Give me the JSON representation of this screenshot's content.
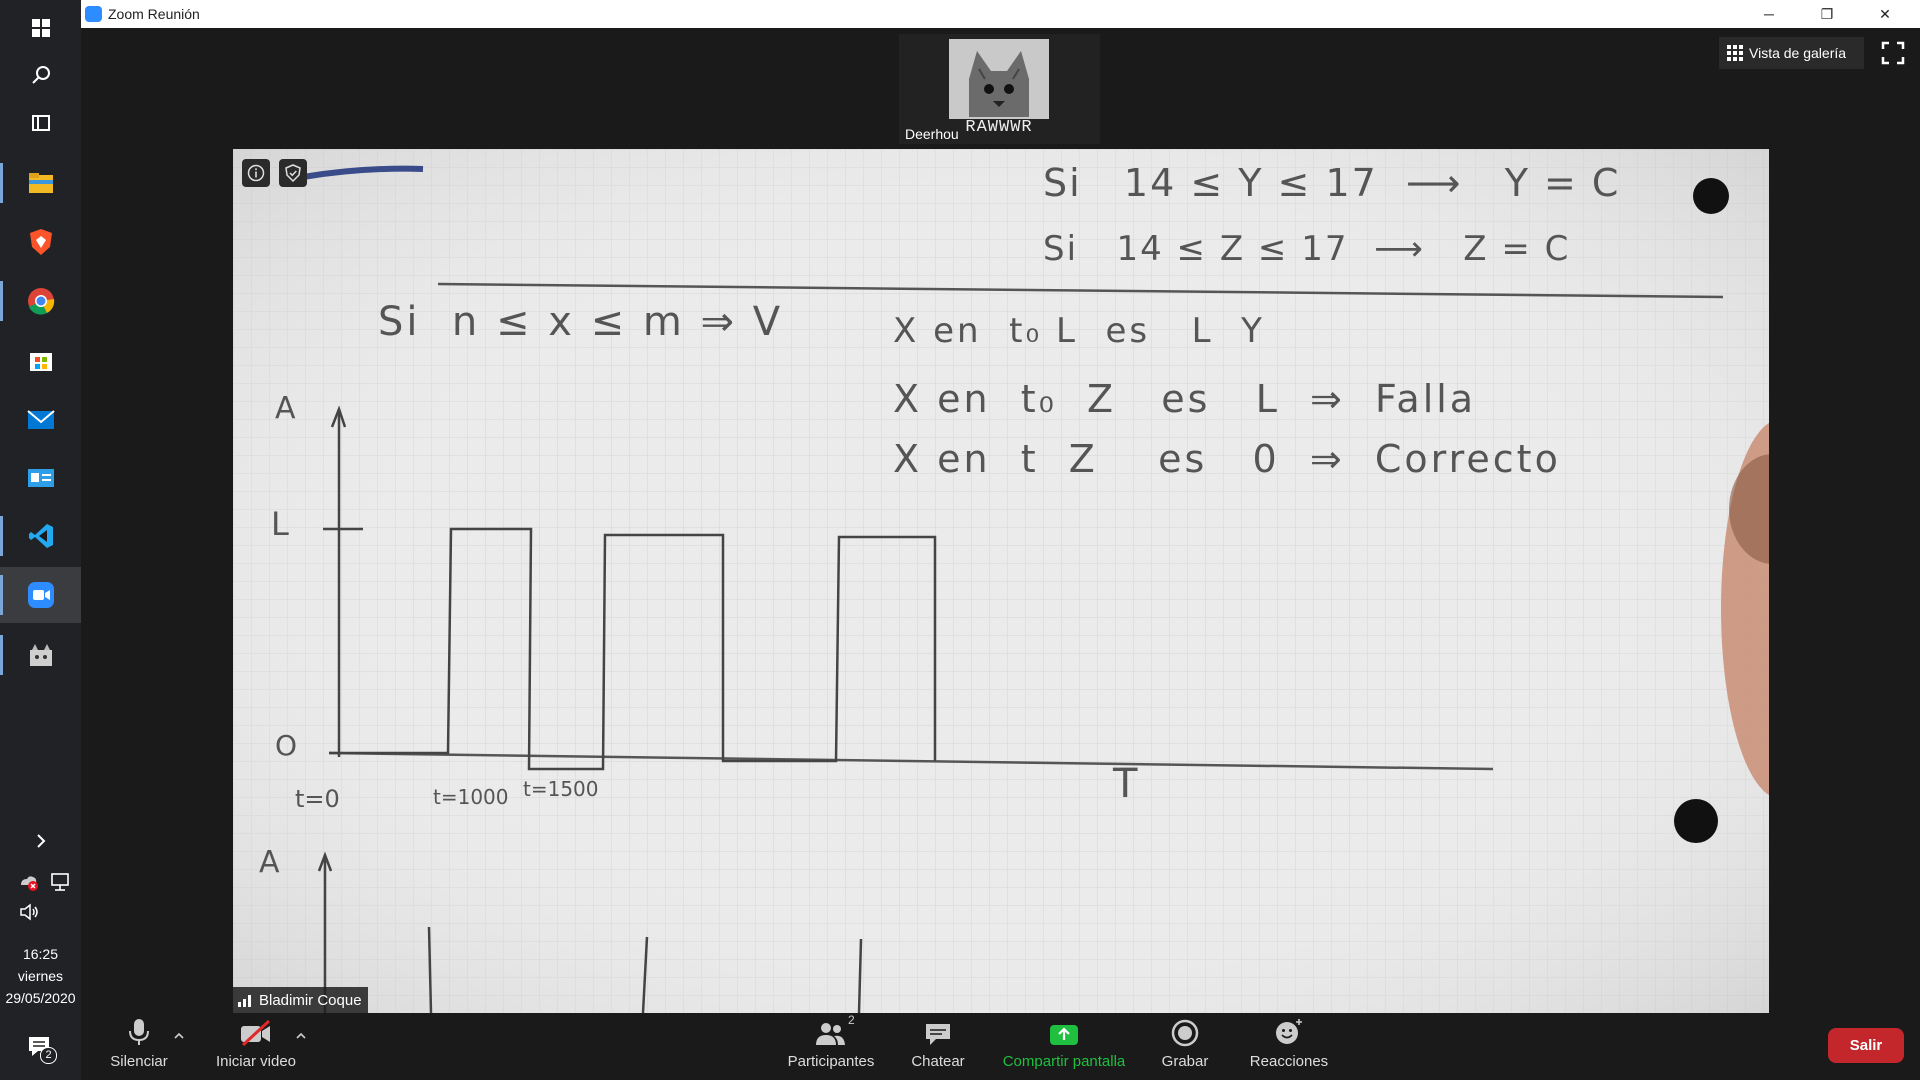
{
  "window": {
    "title": "Zoom Reunión",
    "minimize": "─",
    "restore": "❐",
    "close": "✕"
  },
  "taskbar": {
    "apps": [
      {
        "name": "windows-start-icon"
      },
      {
        "name": "search-icon"
      },
      {
        "name": "task-view-icon"
      },
      {
        "name": "file-explorer-icon"
      },
      {
        "name": "brave-browser-icon"
      },
      {
        "name": "chrome-icon"
      },
      {
        "name": "microsoft-store-icon"
      },
      {
        "name": "mail-icon"
      },
      {
        "name": "contacts-card-icon"
      },
      {
        "name": "vscode-icon"
      },
      {
        "name": "zoom-icon"
      },
      {
        "name": "kitty-app-icon"
      }
    ],
    "time": "16:25",
    "weekday": "viernes",
    "date": "29/05/2020",
    "notifications_count": "2"
  },
  "participant_thumbnail": {
    "name": "Deerhou",
    "image_caption": "RAWWWR"
  },
  "view_controls": {
    "gallery_label": "Vista de galería"
  },
  "shared_screen": {
    "speaker_name": "Bladimir Coque",
    "handwriting": {
      "line1": "Si   14 ≤ Y ≤ 17  ⟶   Y = C",
      "line2": "Si   14 ≤ Z ≤ 17  ⟶   Z = C",
      "line3": "Si  n ≤ x ≤ m ⇒ V",
      "line4": "X en  t₀ L  es   L  Y",
      "line5": "X en  t₀  Z   es   L  ⇒  Falla",
      "line6": "X en  t  Z    es   0  ⇒  Correcto",
      "axis_a": "A",
      "axis_l": "L",
      "axis_o": "O",
      "t0": "t=0",
      "t1": "t=1000",
      "t2": "t=1500",
      "taxis": "T",
      "axis_a2": "A"
    }
  },
  "toolbar": {
    "mute": "Silenciar",
    "video": "Iniciar video",
    "participants": "Participantes",
    "participants_count": "2",
    "chat": "Chatear",
    "share": "Compartir pantalla",
    "record": "Grabar",
    "reactions": "Reacciones",
    "leave": "Salir"
  },
  "colors": {
    "share_green": "#1fbf3f",
    "leave_red": "#c3262b",
    "zoom_blue": "#2d8cff"
  }
}
